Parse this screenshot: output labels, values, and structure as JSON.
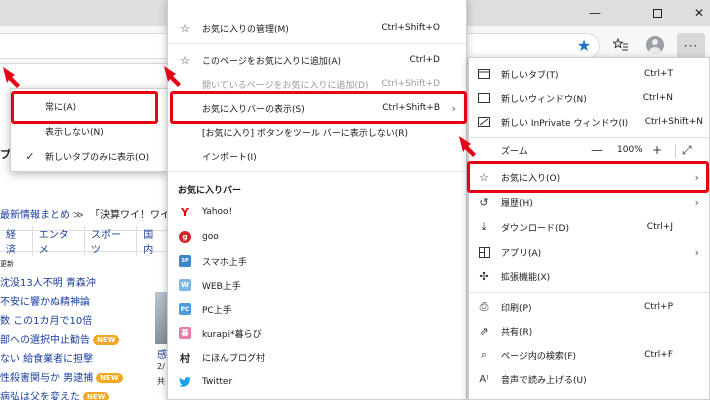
{
  "window": {
    "minimize": "—",
    "close": "✕"
  },
  "toolbar": {
    "more": "···"
  },
  "background_page": {
    "news_head": "最新情報まとめ",
    "news_tab": "「決算ワイ！ワイ",
    "nav": [
      "経済",
      "エンタメ",
      "スポーツ",
      "国内"
    ],
    "update_label": "更新",
    "headlines": [
      "沈没13人不明 青森沖",
      "不安に響かぬ精神論",
      "数 この1カ月で10倍",
      "部への選択中止勧告",
      "ない 給食業者に担撃",
      "性殺害関与か 男逮捕",
      "病弘は父を変えた"
    ],
    "new_badge": "NEW",
    "photo_caption": "感",
    "left_partial": "プ",
    "date_partial": "2/",
    "shared_partial": "共"
  },
  "left_submenu": {
    "items": [
      {
        "label": "常に(A)",
        "checked": false
      },
      {
        "label": "表示しない(N)",
        "checked": false
      },
      {
        "label": "新しいタブのみに表示(O)",
        "checked": true
      }
    ]
  },
  "favorites_menu": {
    "items": [
      {
        "label": "お気に入りの管理(M)",
        "shortcut": "Ctrl+Shift+O",
        "icon": "favorites-manage-icon"
      },
      {
        "label": "このページをお気に入りに追加(A)",
        "shortcut": "Ctrl+D",
        "icon": "star-add-icon"
      },
      {
        "label": "開いているページをお気に入りに追加(D)",
        "shortcut": "Ctrl+Shift+D",
        "disabled": true
      },
      {
        "label": "お気に入りバーの表示(S)",
        "shortcut": "Ctrl+Shift+B",
        "submenu": true
      },
      {
        "label": "[お気に入り] ボタンをツール バーに表示しない(R)"
      },
      {
        "label": "インポート(I)"
      }
    ],
    "bar_heading": "お気に入りバー",
    "bar_items": [
      {
        "label": "Yahoo!",
        "icon": "yahoo-icon"
      },
      {
        "label": "goo",
        "icon": "goo-icon"
      },
      {
        "label": "スマホ上手",
        "icon": "sumaho-icon"
      },
      {
        "label": "WEB上手",
        "icon": "web-jouzu-icon"
      },
      {
        "label": "PC上手",
        "icon": "pc-jouzu-icon"
      },
      {
        "label": "kurapi*暮らび",
        "icon": "kurapi-icon"
      },
      {
        "label": "にほんブログ村",
        "icon": "blogmura-icon"
      },
      {
        "label": "Twitter",
        "icon": "twitter-icon"
      }
    ]
  },
  "settings_menu": {
    "items": [
      {
        "label": "新しいタブ(T)",
        "shortcut": "Ctrl+T"
      },
      {
        "label": "新しいウィンドウ(N)",
        "shortcut": "Ctrl+N"
      },
      {
        "label": "新しい InPrivate ウィンドウ(I)",
        "shortcut": "Ctrl+Shift+N"
      },
      {
        "label": "ズーム",
        "zoom": "100%",
        "minus": "—",
        "plus": "+"
      },
      {
        "label": "お気に入り(O)",
        "submenu": true
      },
      {
        "label": "履歴(H)",
        "submenu": true
      },
      {
        "label": "ダウンロード(D)",
        "shortcut": "Ctrl+J"
      },
      {
        "label": "アプリ(A)",
        "submenu": true
      },
      {
        "label": "拡張機能(X)"
      },
      {
        "label": "印刷(P)",
        "shortcut": "Ctrl+P"
      },
      {
        "label": "共有(R)"
      },
      {
        "label": "ページ内の検索(F)",
        "shortcut": "Ctrl+F"
      },
      {
        "label": "音声で読み上げる(U)"
      }
    ]
  },
  "colors": {
    "highlight": "#e60012",
    "accent_blue": "#1a73c7"
  }
}
